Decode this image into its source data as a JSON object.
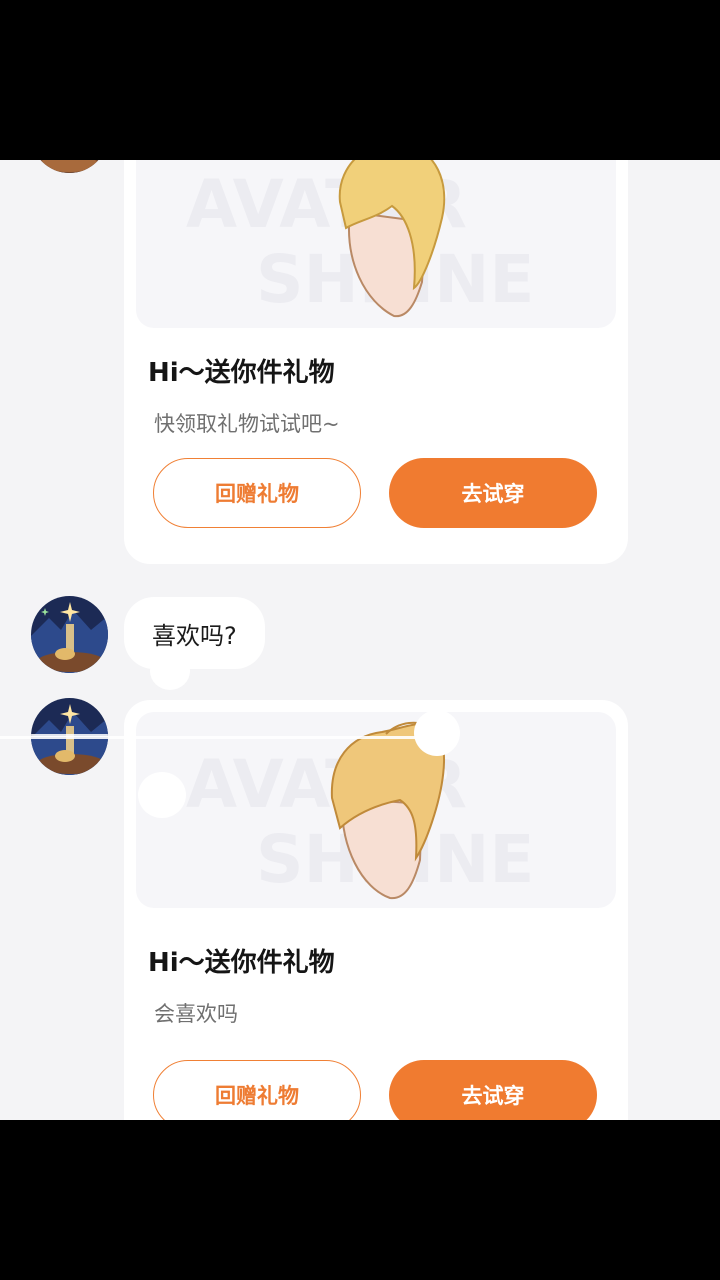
{
  "messages": [
    {
      "type": "gift_card",
      "title": "Hi～送你件礼物",
      "subtitle": "快领取礼物试试吧~",
      "return_gift_label": "回赠礼物",
      "try_on_label": "去试穿",
      "preview_icon": "blonde-bun-hair-icon"
    },
    {
      "type": "text",
      "text": "喜欢吗?"
    },
    {
      "type": "gift_card",
      "title": "Hi～送你件礼物",
      "subtitle": "会喜欢吗",
      "return_gift_label": "回赠礼物",
      "try_on_label": "去试穿",
      "preview_icon": "blonde-ponytail-hair-icon"
    }
  ],
  "preview_watermark": {
    "line1": "AVATAR",
    "line2": "SHRINE"
  },
  "colors": {
    "accent": "#f07b30",
    "background": "#f4f4f6",
    "card": "#ffffff"
  }
}
